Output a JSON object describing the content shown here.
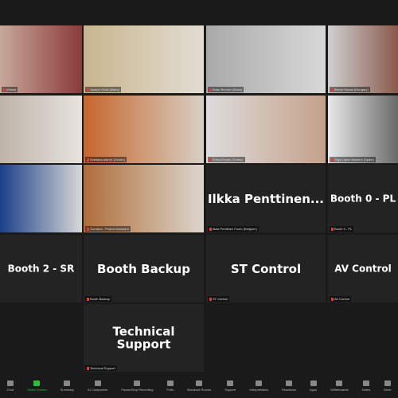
{
  "tiles": [
    {
      "label": "(Malta)",
      "video": true,
      "bg": "linear-gradient(90deg,#c7a89a,#8a3a3a)"
    },
    {
      "label": "Joseph Grixti (Malta)",
      "video": true,
      "bg": "linear-gradient(90deg,#c9b58e,#e2ddd2)"
    },
    {
      "label": "Brian Bonnici (Malta)",
      "video": true,
      "bg": "linear-gradient(90deg,#a9a9a9,#d8d8d8)"
    },
    {
      "label": "Bence Havas (Hungary)",
      "video": true,
      "bg": "linear-gradient(90deg,#cfcfcf,#8a5a4a)"
    },
    {
      "label": "",
      "video": true,
      "bg": "linear-gradient(90deg,#bfb3a8,#e6e3de)"
    },
    {
      "label": "Svetlana Marzić (Serbia)",
      "video": true,
      "bg": "linear-gradient(90deg,#c7662e,#d8cfc4)"
    },
    {
      "label": "Erenç Eraçik (Turkey)",
      "video": true,
      "bg": "linear-gradient(90deg,#dcdcdc,#c6a18a)"
    },
    {
      "label": "Olga López Maceiro (Spain)",
      "video": true,
      "bg": "linear-gradient(90deg,#e8e8e8,#6a6a6a)"
    },
    {
      "label": "",
      "video": true,
      "bg": "linear-gradient(90deg,#1b3f8a,#d7d7d7)"
    },
    {
      "label": "Gordana - Project Assistant",
      "video": true,
      "bg": "linear-gradient(90deg,#b06d3a,#dcd6cc)"
    },
    {
      "label": "Ilkka Penttinen Fouto (Belgium)",
      "big": "Ilkka  Penttinen..."
    },
    {
      "label": "Booth 0 - PL",
      "big": "Booth 0 - PL"
    },
    {
      "label": "",
      "big": "Booth 2 - SR"
    },
    {
      "label": "Booth Backup",
      "big": "Booth Backup"
    },
    {
      "label": "ST Control",
      "big": "ST Control"
    },
    {
      "label": "AV Control",
      "big": "AV Control"
    },
    {
      "label": "Technical Support",
      "big": "Technical Support"
    }
  ],
  "toolbar": [
    {
      "label": "Chat",
      "icon": "chat-icon"
    },
    {
      "label": "Share Screen",
      "icon": "share-screen-icon"
    },
    {
      "label": "Summary",
      "icon": "summary-icon"
    },
    {
      "label": "AI Companion",
      "icon": "ai-companion-icon"
    },
    {
      "label": "Pause/Stop Recording",
      "icon": "recording-icon"
    },
    {
      "label": "Polls",
      "icon": "polls-icon"
    },
    {
      "label": "Breakout Rooms",
      "icon": "breakout-rooms-icon"
    },
    {
      "label": "Support",
      "icon": "support-icon"
    },
    {
      "label": "Interpretation",
      "icon": "interpretation-icon"
    },
    {
      "label": "Reactions",
      "icon": "reactions-icon"
    },
    {
      "label": "Apps",
      "icon": "apps-icon"
    },
    {
      "label": "Whiteboards",
      "icon": "whiteboards-icon"
    },
    {
      "label": "Notes",
      "icon": "notes-icon"
    },
    {
      "label": "More",
      "icon": "more-icon"
    }
  ],
  "colors": {
    "share_screen": "#2dbf3b",
    "muted_mic": "#e03c3c"
  }
}
